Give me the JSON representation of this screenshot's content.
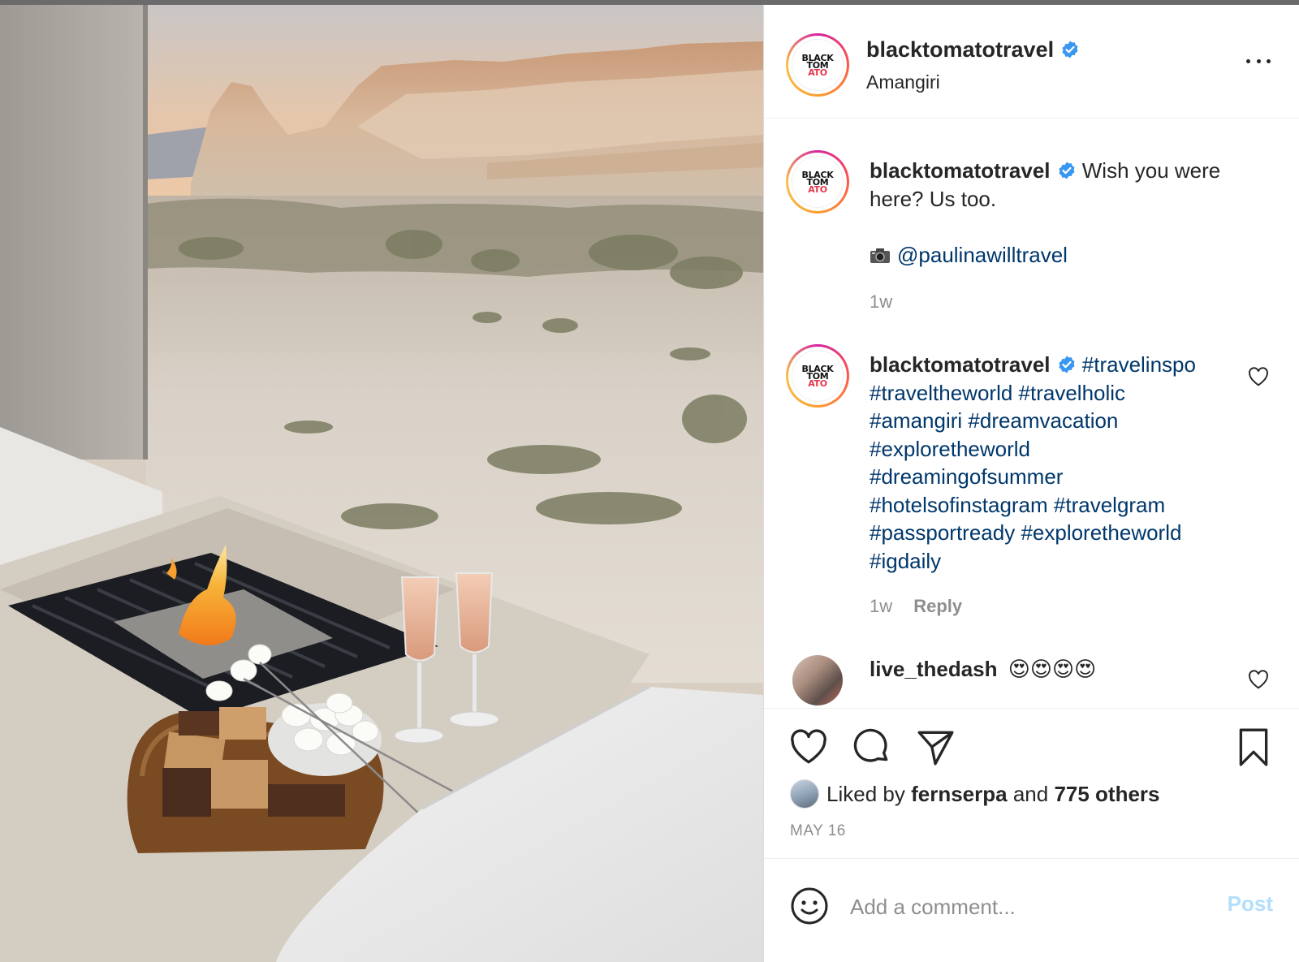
{
  "post": {
    "username": "blacktomatotravel",
    "location": "Amangiri",
    "avatar_logo_lines": [
      "BLACK",
      "TOM",
      "ATO"
    ]
  },
  "caption": {
    "username": "blacktomatotravel",
    "text": "Wish you were here? Us too.",
    "photo_credit_icon": "camera-emoji",
    "photo_credit": "@paulinawilltravel",
    "time": "1w"
  },
  "hashtag_comment": {
    "username": "blacktomatotravel",
    "lines": [
      "#travelinspo",
      "#traveltheworld #travelholic",
      "#amangiri #dreamvacation",
      "#exploretheworld",
      "#dreamingofsummer",
      "#hotelsofinstagram #travelgram",
      "#passportready #exploretheworld",
      "#igdaily"
    ],
    "time": "1w",
    "reply_label": "Reply"
  },
  "user_comment": {
    "username": "live_thedash",
    "text": "😍😍😍😍"
  },
  "engagement": {
    "liked_by_prefix": "Liked by",
    "liked_by_user": "fernserpa",
    "liked_by_middle": "and",
    "others": "775 others",
    "date": "MAY 16"
  },
  "comment_box": {
    "placeholder": "Add a comment...",
    "post_label": "Post"
  },
  "colors": {
    "hashtag": "#00376b",
    "verified": "#3897f0",
    "muted": "#8e8e8e",
    "post_disabled": "#b2dffc"
  }
}
